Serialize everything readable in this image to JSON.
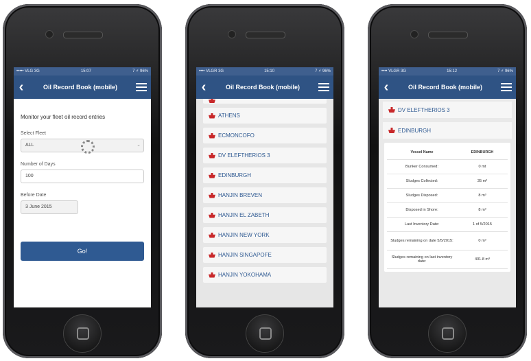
{
  "statusbar": {
    "left": [
      "••••• VLG 3G",
      "•••• VLGR 3G",
      "•••• VLGR 3G"
    ],
    "time": [
      "15:07",
      "15:10",
      "15:12"
    ],
    "right": [
      "7 ⚡ 96%",
      "7 ⚡ 96%",
      "7 ⚡ 96%"
    ]
  },
  "nav": {
    "title": "Oil Record Book (mobile)",
    "back": "‹"
  },
  "screen1": {
    "intro": "Monitor your fleet oil record entries",
    "fleet_label": "Select Fleet",
    "fleet_value": "ALL",
    "days_label": "Number of Days",
    "days_value": "100",
    "date_label": "Before Date",
    "date_value": "3 June 2015",
    "go_label": "Go!"
  },
  "screen2": {
    "vessels": [
      "ATHENS",
      "ECMONCOFO",
      "DV ELEFTHERIOS 3",
      "EDINBURGH",
      "HANJIN BREVEN",
      "HANJIN EL ZABETH",
      "HANJIN NEW YORK",
      "HANJIN SINGAPOFE",
      "HANJIN YOKOHAMA"
    ]
  },
  "screen3": {
    "vessels": [
      "DV ELEFTHERIOS 3",
      "EDINBURGH"
    ],
    "table_header": {
      "key": "Vessel Name",
      "value": "EDINBURGH"
    },
    "rows": [
      {
        "key": "Bunker Consumed:",
        "value": "0 mt"
      },
      {
        "key": "Sludges Collected:",
        "value": "35 m³"
      },
      {
        "key": "Sludges Disposed:",
        "value": "8 m³"
      },
      {
        "key": "Disposed in Shore:",
        "value": "8 m³"
      },
      {
        "key": "Last Inventory Date:",
        "value": "1 of 5/2015"
      },
      {
        "key": "Sludges remaining on date 5/5/2015:",
        "value": "0 m³"
      },
      {
        "key": "Sludges remaining on last inventory date:",
        "value": "401.8 m³"
      }
    ]
  }
}
